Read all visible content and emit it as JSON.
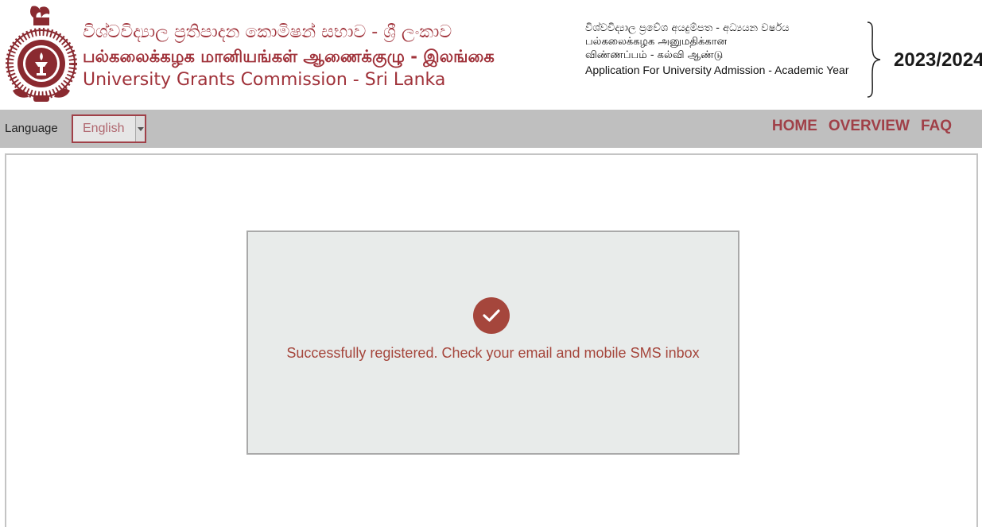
{
  "header": {
    "title_si": "විශ්වවිද්‍යාල ප්‍රතිපාදන කොමිෂන් සභාව - ශ්‍රී ලංකාව",
    "title_ta": "பல்கலைக்கழக மானியங்கள் ஆணைக்குழு - இலங்கை",
    "title_en": "University Grants Commission - Sri Lanka",
    "application": {
      "line_si": "විශ්වවිද්‍යාල ප්‍රවේශ අයදුම්පත - අධ්‍යයන වර්ෂය",
      "line_ta_1": "பல்கலைக்கழக அனுமதிக்கான",
      "line_ta_2": "விண்ணப்பம் - கல்வி ஆண்டு",
      "line_en": "Application For University Admission - Academic Year"
    },
    "year": "2023/2024"
  },
  "navbar": {
    "language_label": "Language",
    "language_value": "English",
    "links": {
      "home": "HOME",
      "overview": "OVERVIEW",
      "faq": "FAQ"
    }
  },
  "main": {
    "message": "Successfully registered. Check your email and mobile SMS inbox"
  },
  "colors": {
    "brand": "#a0323a",
    "nav_bg": "#bfbfbf",
    "success_icon": "#a5463c",
    "message_box_bg": "#e8ebea"
  },
  "icons": {
    "logo": "ugc-emblem-icon",
    "check": "check-circle-icon",
    "dropdown": "chevron-down-icon"
  }
}
